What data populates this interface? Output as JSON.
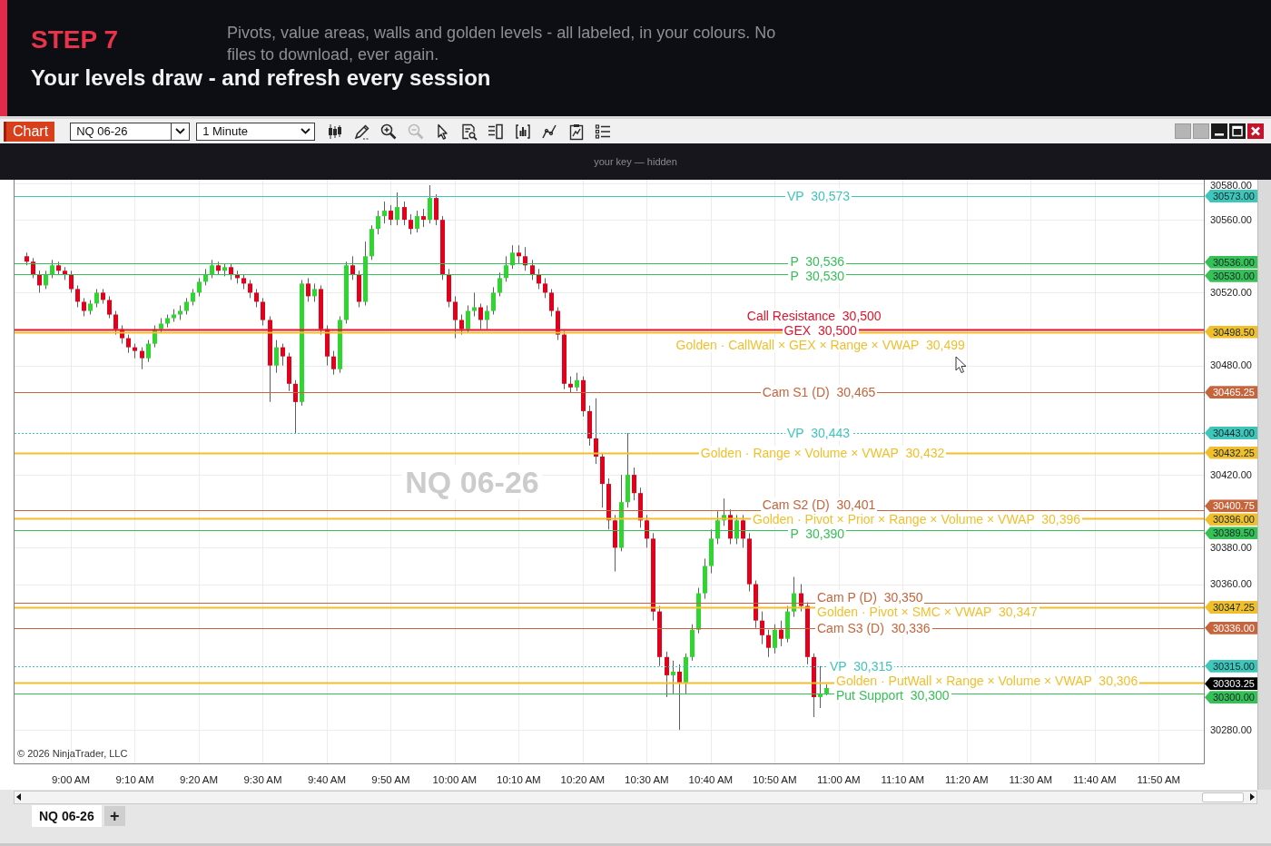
{
  "header": {
    "step": "STEP 7",
    "description": "Pivots, value areas, walls and golden levels - all labeled, in your colours. No files to download, ever again.",
    "title": "Your levels draw - and refresh every session"
  },
  "toolbar": {
    "chart_button": "Chart",
    "instrument": "NQ 06-26",
    "interval": "1 Minute",
    "tools": [
      {
        "disabled": false
      },
      {
        "disabled": false
      },
      {
        "disabled": false
      },
      {
        "disabled": true
      },
      {
        "disabled": false
      },
      {
        "disabled": false
      },
      {
        "disabled": false
      },
      {
        "disabled": false
      },
      {
        "disabled": false
      },
      {
        "disabled": false
      },
      {
        "disabled": false
      }
    ]
  },
  "notice": "your key — hidden",
  "chart": {
    "background_label": "NQ 06-26",
    "copyright": "© 2026 NinjaTrader, LLC",
    "time_axis": [
      "9:00 AM",
      "9:10 AM",
      "9:20 AM",
      "9:30 AM",
      "9:40 AM",
      "9:50 AM",
      "10:00 AM",
      "10:10 AM",
      "10:20 AM",
      "10:30 AM",
      "10:40 AM",
      "10:50 AM",
      "11:00 AM",
      "11:10 AM",
      "11:20 AM",
      "11:30 AM",
      "11:40 AM",
      "11:50 AM"
    ],
    "price_axis": [
      "30580.00",
      "30560.00",
      "30520.00",
      "30480.00",
      "30420.00",
      "30380.00",
      "30360.00",
      "30280.00"
    ],
    "levels": [
      {
        "kind": "thin",
        "label": "VP  30,573",
        "tag": "30573.00",
        "color": "#3ec6bb"
      },
      {
        "kind": "thin",
        "label": "P  30,536",
        "tag": "30536.00",
        "color": "#36c157"
      },
      {
        "kind": "thin",
        "label": "P  30,530",
        "tag": "30530.00",
        "color": "#36c157"
      },
      {
        "kind": "thick",
        "label": "Call Resistance  30,500",
        "color": "#e0142c"
      },
      {
        "kind": "thick",
        "label": "GEX  30,500",
        "color": "#e0142c"
      },
      {
        "kind": "thick",
        "label": "Golden · CallWall × GEX × Range × VWAP  30,499",
        "tag": "30498.50",
        "color": "#f2bf2c"
      },
      {
        "kind": "thin",
        "label": "Cam S1 (D)  30,465",
        "tag": "30465.25",
        "color": "#c7643b"
      },
      {
        "kind": "dotted",
        "label": "VP  30,443",
        "tag": "30443.00",
        "color": "#3ec6bb"
      },
      {
        "kind": "thick",
        "label": "Golden · Range × Volume × VWAP  30,432",
        "tag": "30432.25",
        "color": "#f2bf2c"
      },
      {
        "kind": "thin",
        "label": "Cam S2 (D)  30,401",
        "tag": "30400.75",
        "color": "#c7643b"
      },
      {
        "kind": "thick",
        "label": "Golden · Pivot × Prior × Range × Volume × VWAP  30,396",
        "tag": "30396.00",
        "color": "#f2bf2c"
      },
      {
        "kind": "thin",
        "label": "P  30,390",
        "tag": "30389.50",
        "color": "#36c157"
      },
      {
        "kind": "thin",
        "label": "Cam P (D)  30,350",
        "color": "#c7643b"
      },
      {
        "kind": "thick",
        "label": "Golden · Pivot × SMC × VWAP  30,347",
        "tag": "30347.25",
        "color": "#f2bf2c"
      },
      {
        "kind": "thin",
        "label": "Cam S3 (D)  30,336",
        "tag": "30336.00",
        "color": "#c7643b"
      },
      {
        "kind": "dotted",
        "label": "VP  30,315",
        "tag": "30315.00",
        "color": "#3ec6bb"
      },
      {
        "kind": "thick",
        "label": "Golden · PutWall × Range × Volume × VWAP  30,306",
        "color": "#f2bf2c"
      },
      {
        "kind": "thin",
        "label": "Put Support  30,300",
        "tag": "30300.00",
        "color": "#36c157"
      }
    ],
    "last_price": {
      "tag": "30303.25"
    }
  },
  "tabs": [
    {
      "label": "NQ 06-26",
      "selected": true
    }
  ],
  "add_tab": "+"
}
